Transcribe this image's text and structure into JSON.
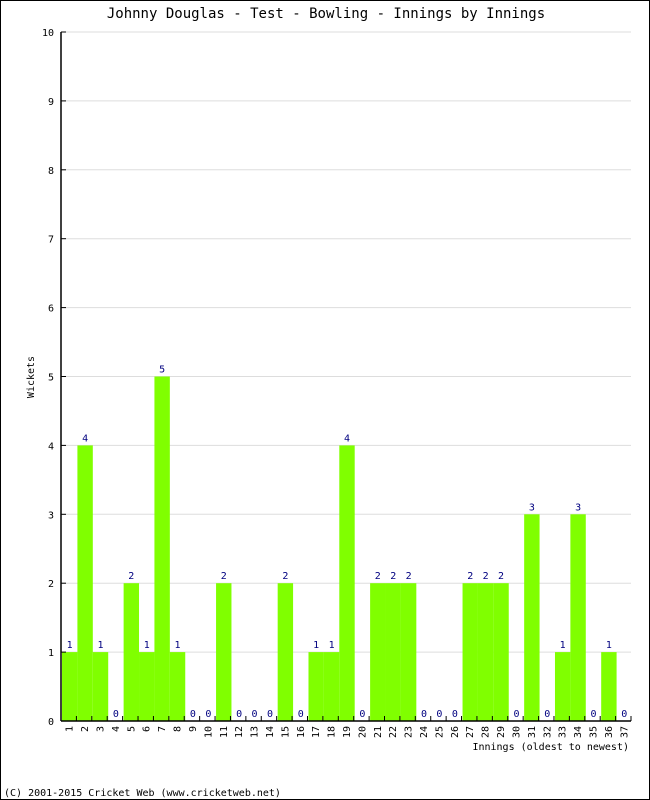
{
  "chart_data": {
    "type": "bar",
    "title": "Johnny Douglas - Test - Bowling - Innings by Innings",
    "xlabel": "Innings (oldest to newest)",
    "ylabel": "Wickets",
    "ylim": [
      0,
      10
    ],
    "yticks": [
      "0",
      "1",
      "2",
      "3",
      "4",
      "5",
      "6",
      "7",
      "8",
      "9",
      "10"
    ],
    "grid": true,
    "categories": [
      "1",
      "2",
      "3",
      "4",
      "5",
      "6",
      "7",
      "8",
      "9",
      "10",
      "11",
      "12",
      "13",
      "14",
      "15",
      "16",
      "17",
      "18",
      "19",
      "20",
      "21",
      "22",
      "23",
      "24",
      "25",
      "26",
      "27",
      "28",
      "29",
      "30",
      "31",
      "32",
      "33",
      "34",
      "35",
      "36",
      "37"
    ],
    "values": [
      1,
      4,
      1,
      0,
      2,
      1,
      5,
      1,
      0,
      0,
      2,
      0,
      0,
      0,
      2,
      0,
      1,
      1,
      4,
      0,
      2,
      2,
      2,
      0,
      0,
      0,
      2,
      2,
      2,
      0,
      3,
      0,
      1,
      3,
      0,
      1,
      0
    ],
    "bar_color": "#80ff00",
    "label_color": "#000080"
  },
  "footer": "(C) 2001-2015 Cricket Web (www.cricketweb.net)"
}
